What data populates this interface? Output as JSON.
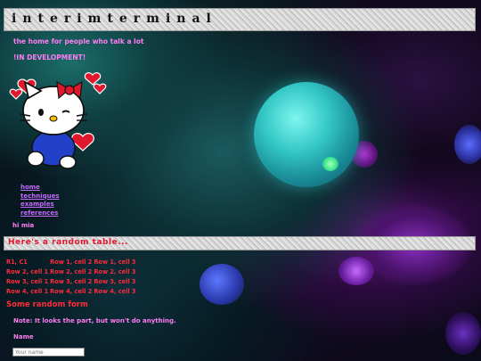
{
  "site": {
    "title": "interimterminal",
    "tagline": "the home for people who talk a lot",
    "status": "!IN DEVELOPMENT!"
  },
  "nav": {
    "items": [
      {
        "label": "home"
      },
      {
        "label": "techniques"
      },
      {
        "label": "examples"
      },
      {
        "label": "references"
      }
    ]
  },
  "greeting": "hi mia",
  "table_section": {
    "heading": "Here's a random table...",
    "rows": [
      [
        "R1, C1",
        "Row 1, cell 2",
        "Row 1, cell 3"
      ],
      [
        "Row 2, cell 1",
        "Row 2, cell 2",
        "Row 2, cell 3"
      ],
      [
        "Row 3, cell 1",
        "Row 3, cell 2",
        "Row 3, cell 3"
      ],
      [
        "Row 4, cell 1",
        "Row 4, cell 2",
        "Row 4, cell 3"
      ]
    ]
  },
  "form": {
    "heading": "Some random form",
    "note_label": "Note:",
    "note_text": "It looks the part, but won't do anything.",
    "name_label": "Name",
    "name_placeholder": "Your name"
  },
  "colors": {
    "pink_text": "#ff7cf2",
    "red_text": "#ff2a3a",
    "link_purple": "#c46bff"
  }
}
